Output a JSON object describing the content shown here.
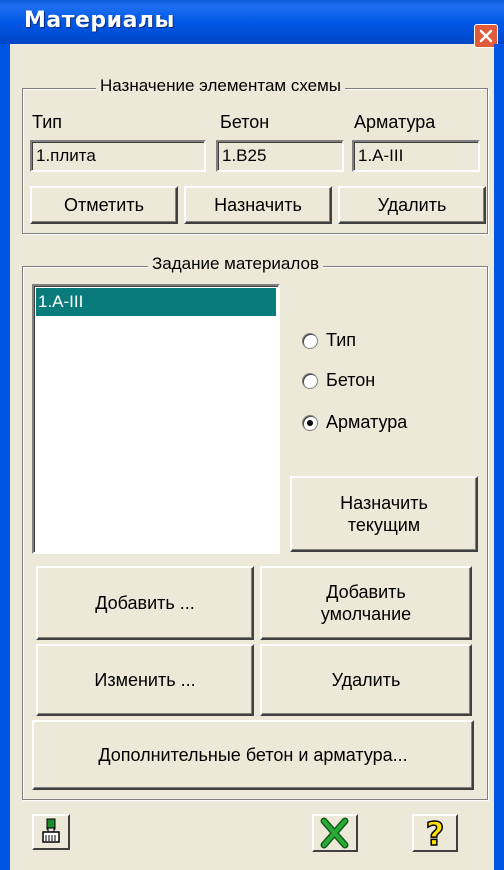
{
  "window": {
    "title": "Материалы"
  },
  "assign_group": {
    "legend": "Назначение элементам схемы",
    "col_type": "Тип",
    "col_concrete": "Бетон",
    "col_rebar": "Арматура",
    "type_value": "1.плита",
    "concrete_value": "1.B25",
    "rebar_value": "1.A-III",
    "mark_label": "Отметить",
    "assign_label": "Назначить",
    "delete_label": "Удалить"
  },
  "materials_group": {
    "legend": "Задание материалов",
    "list_items": [
      "1.A-III"
    ],
    "radio_type": "Тип",
    "radio_concrete": "Бетон",
    "radio_rebar": "Арматура",
    "selected_radio": "Арматура",
    "set_current_line1": "Назначить",
    "set_current_line2": "текущим",
    "add_label": "Добавить ...",
    "add_default_line1": "Добавить",
    "add_default_line2": "умолчание",
    "edit_label": "Изменить ...",
    "delete_label": "Удалить",
    "extra_label": "Дополнительные бетон и арматура..."
  },
  "footer": {
    "icons": [
      "brush-icon",
      "cancel-icon",
      "help-icon"
    ],
    "help_glyph": "?"
  },
  "colors": {
    "title_bar": "#0054e3",
    "selection": "#0a7b7b",
    "face": "#ece9d8",
    "cancel_green": "#1a8a2a",
    "help_yellow": "#ffe000"
  }
}
